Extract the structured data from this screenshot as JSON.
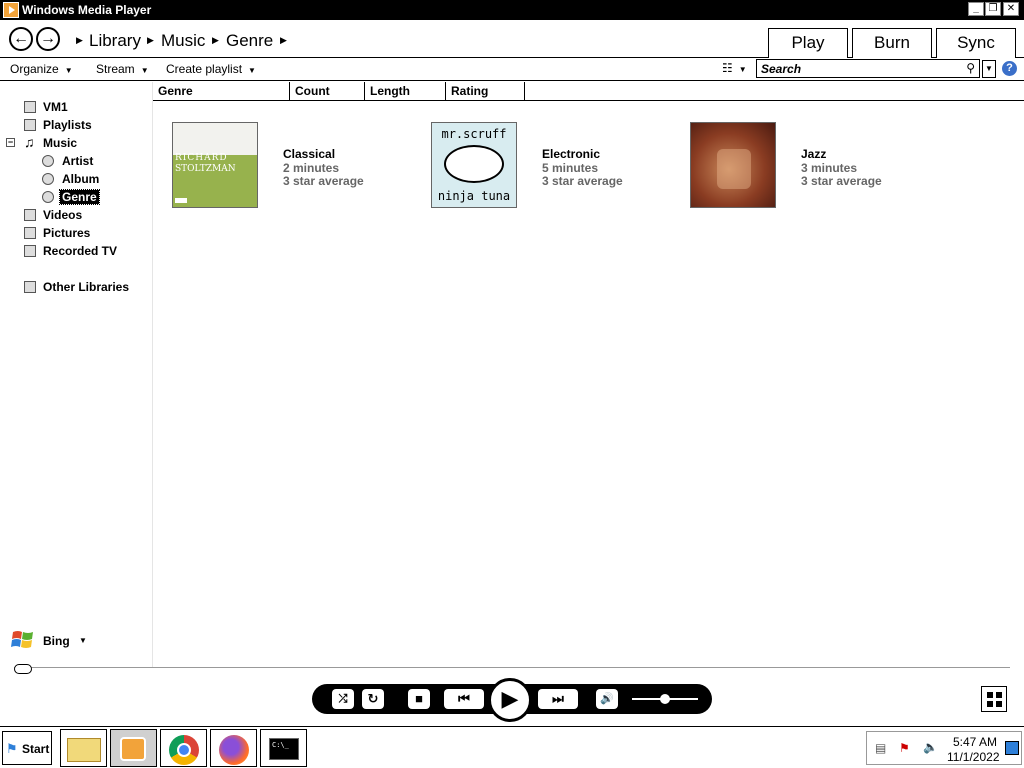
{
  "window": {
    "title": "Windows Media Player",
    "controls": [
      "minimize",
      "maximize",
      "close"
    ]
  },
  "nav": {
    "breadcrumbs": [
      "Library",
      "Music",
      "Genre"
    ],
    "tabs": [
      "Play",
      "Burn",
      "Sync"
    ]
  },
  "toolbar": {
    "organize": "Organize",
    "stream": "Stream",
    "create_playlist": "Create playlist",
    "search_placeholder": "Search"
  },
  "sidebar": {
    "items": [
      {
        "label": "VM1",
        "icon": "library-icon"
      },
      {
        "label": "Playlists",
        "icon": "playlist-icon"
      },
      {
        "label": "Music",
        "icon": "music-note-icon",
        "expanded": true
      },
      {
        "label": "Artist",
        "icon": "artist-icon"
      },
      {
        "label": "Album",
        "icon": "album-icon"
      },
      {
        "label": "Genre",
        "icon": "genre-icon",
        "selected": true
      },
      {
        "label": "Videos",
        "icon": "video-icon"
      },
      {
        "label": "Pictures",
        "icon": "picture-icon"
      },
      {
        "label": "Recorded TV",
        "icon": "tv-icon"
      },
      {
        "label": "Other Libraries",
        "icon": "other-libraries-icon"
      }
    ],
    "bing": "Bing"
  },
  "columns": [
    "Genre",
    "Count",
    "Length",
    "Rating"
  ],
  "genres": [
    {
      "name": "Classical",
      "length": "2 minutes",
      "rating": "3 star average",
      "art_text_1": "RICHARD",
      "art_text_2": "STOLTZMAN"
    },
    {
      "name": "Electronic",
      "length": "5 minutes",
      "rating": "3 star average",
      "art_text_1": "mr.scruff",
      "art_text_2": "ninja tuna"
    },
    {
      "name": "Jazz",
      "length": "3 minutes",
      "rating": "3 star average"
    }
  ],
  "taskbar": {
    "start": "Start",
    "time": "5:47 AM",
    "date": "11/1/2022"
  }
}
